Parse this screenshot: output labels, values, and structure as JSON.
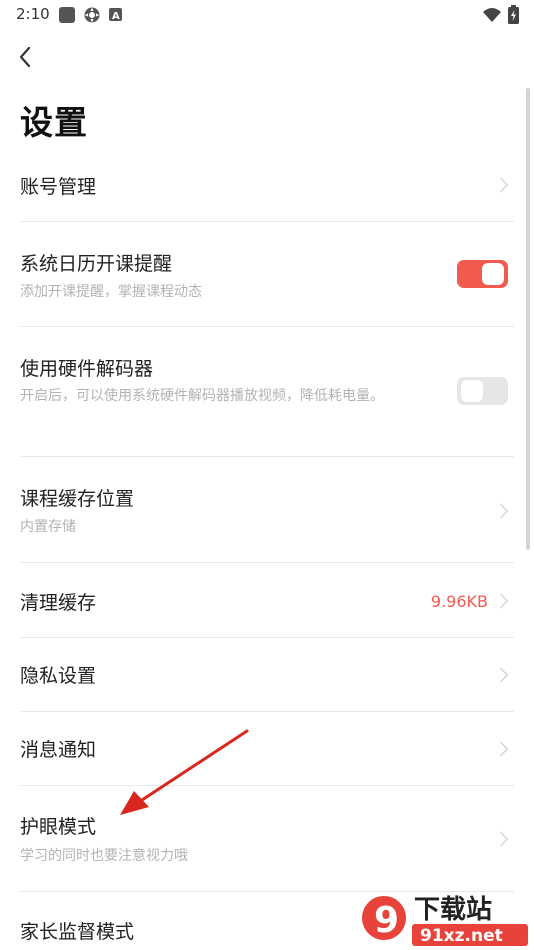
{
  "status_bar": {
    "time": "2:10",
    "icons": [
      "app-square-icon",
      "settings-gear-icon",
      "font-a-icon",
      "wifi-icon",
      "battery-charging-icon"
    ]
  },
  "header": {
    "back_icon": "chevron-left-icon",
    "title": "设置"
  },
  "settings": {
    "account": {
      "label": "账号管理"
    },
    "calendar_reminder": {
      "label": "系统日历开课提醒",
      "desc": "添加开课提醒，掌握课程动态",
      "enabled": true
    },
    "hardware_decoder": {
      "label": "使用硬件解码器",
      "desc": "开启后，可以使用系统硬件解码器播放视频，降低耗电量。",
      "enabled": false
    },
    "cache_location": {
      "label": "课程缓存位置",
      "desc": "内置存储"
    },
    "clear_cache": {
      "label": "清理缓存",
      "value": "9.96KB"
    },
    "privacy": {
      "label": "隐私设置"
    },
    "notifications": {
      "label": "消息通知"
    },
    "eye_protection": {
      "label": "护眼模式",
      "desc": "学习的同时也要注意视力哦"
    },
    "parental_control": {
      "label": "家长监督模式"
    }
  },
  "colors": {
    "accent": "#f15b4f",
    "annotation_arrow": "#d9271e"
  },
  "watermark": {
    "logo_text": "9",
    "name": "下载站",
    "url": "91xz.net"
  }
}
